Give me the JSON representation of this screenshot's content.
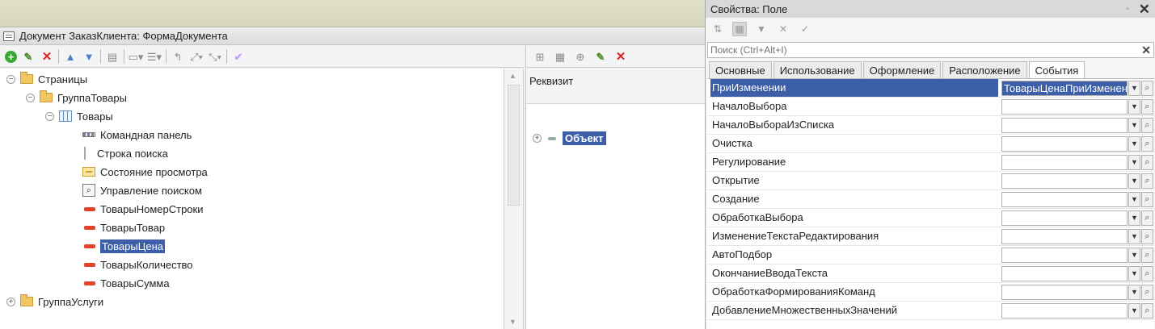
{
  "form_window": {
    "title": "Документ ЗаказКлиента: ФормаДокумента",
    "tree": [
      {
        "label": "Страницы",
        "level": 0,
        "icon": "folder-icon",
        "expander": "minus"
      },
      {
        "label": "ГруппаТовары",
        "level": 1,
        "icon": "folder-icon",
        "expander": "minus"
      },
      {
        "label": "Товары",
        "level": 2,
        "icon": "table-icon",
        "expander": "minus"
      },
      {
        "label": "Командная панель",
        "level": 3,
        "icon": "command-panel-icon"
      },
      {
        "label": "Строка поиска",
        "level": 3,
        "icon": "search-bar-icon"
      },
      {
        "label": "Состояние просмотра",
        "level": 3,
        "icon": "view-state-icon"
      },
      {
        "label": "Управление поиском",
        "level": 3,
        "icon": "search-manager-icon"
      },
      {
        "label": "ТоварыНомерСтроки",
        "level": 3,
        "icon": "field-icon"
      },
      {
        "label": "ТоварыТовар",
        "level": 3,
        "icon": "field-icon"
      },
      {
        "label": "ТоварыЦена",
        "level": 3,
        "icon": "field-icon",
        "selected": true
      },
      {
        "label": "ТоварыКоличество",
        "level": 3,
        "icon": "field-icon"
      },
      {
        "label": "ТоварыСумма",
        "level": 3,
        "icon": "field-icon"
      },
      {
        "label": "ГруппаУслуги",
        "level": 0,
        "icon": "folder-icon",
        "expander": "plus"
      }
    ],
    "attributes": {
      "header": "Реквизит",
      "items": [
        {
          "label": "Объект",
          "selected": true
        }
      ]
    }
  },
  "properties": {
    "title": "Свойства: Поле",
    "search_placeholder": "Поиск (Ctrl+Alt+I)",
    "tabs": [
      {
        "label": "Основные",
        "active": false
      },
      {
        "label": "Использование",
        "active": false
      },
      {
        "label": "Оформление",
        "active": false
      },
      {
        "label": "Расположение",
        "active": false
      },
      {
        "label": "События",
        "active": true
      }
    ],
    "events": [
      {
        "name": "ПриИзменении",
        "value": "ТоварыЦенаПриИзменении",
        "selected": true
      },
      {
        "name": "НачалоВыбора",
        "value": ""
      },
      {
        "name": "НачалоВыбораИзСписка",
        "value": ""
      },
      {
        "name": "Очистка",
        "value": ""
      },
      {
        "name": "Регулирование",
        "value": ""
      },
      {
        "name": "Открытие",
        "value": ""
      },
      {
        "name": "Создание",
        "value": ""
      },
      {
        "name": "ОбработкаВыбора",
        "value": ""
      },
      {
        "name": "ИзменениеТекстаРедактирования",
        "value": ""
      },
      {
        "name": "АвтоПодбор",
        "value": ""
      },
      {
        "name": "ОкончаниеВводаТекста",
        "value": ""
      },
      {
        "name": "ОбработкаФормированияКоманд",
        "value": ""
      },
      {
        "name": "ДобавлениеМножественныхЗначений",
        "value": ""
      }
    ]
  },
  "colors": {
    "selection": "#3c5fa8",
    "add": "#3aa635",
    "delete": "#dd2222",
    "field_marker": "#e4422a",
    "folder": "#f2c661"
  }
}
